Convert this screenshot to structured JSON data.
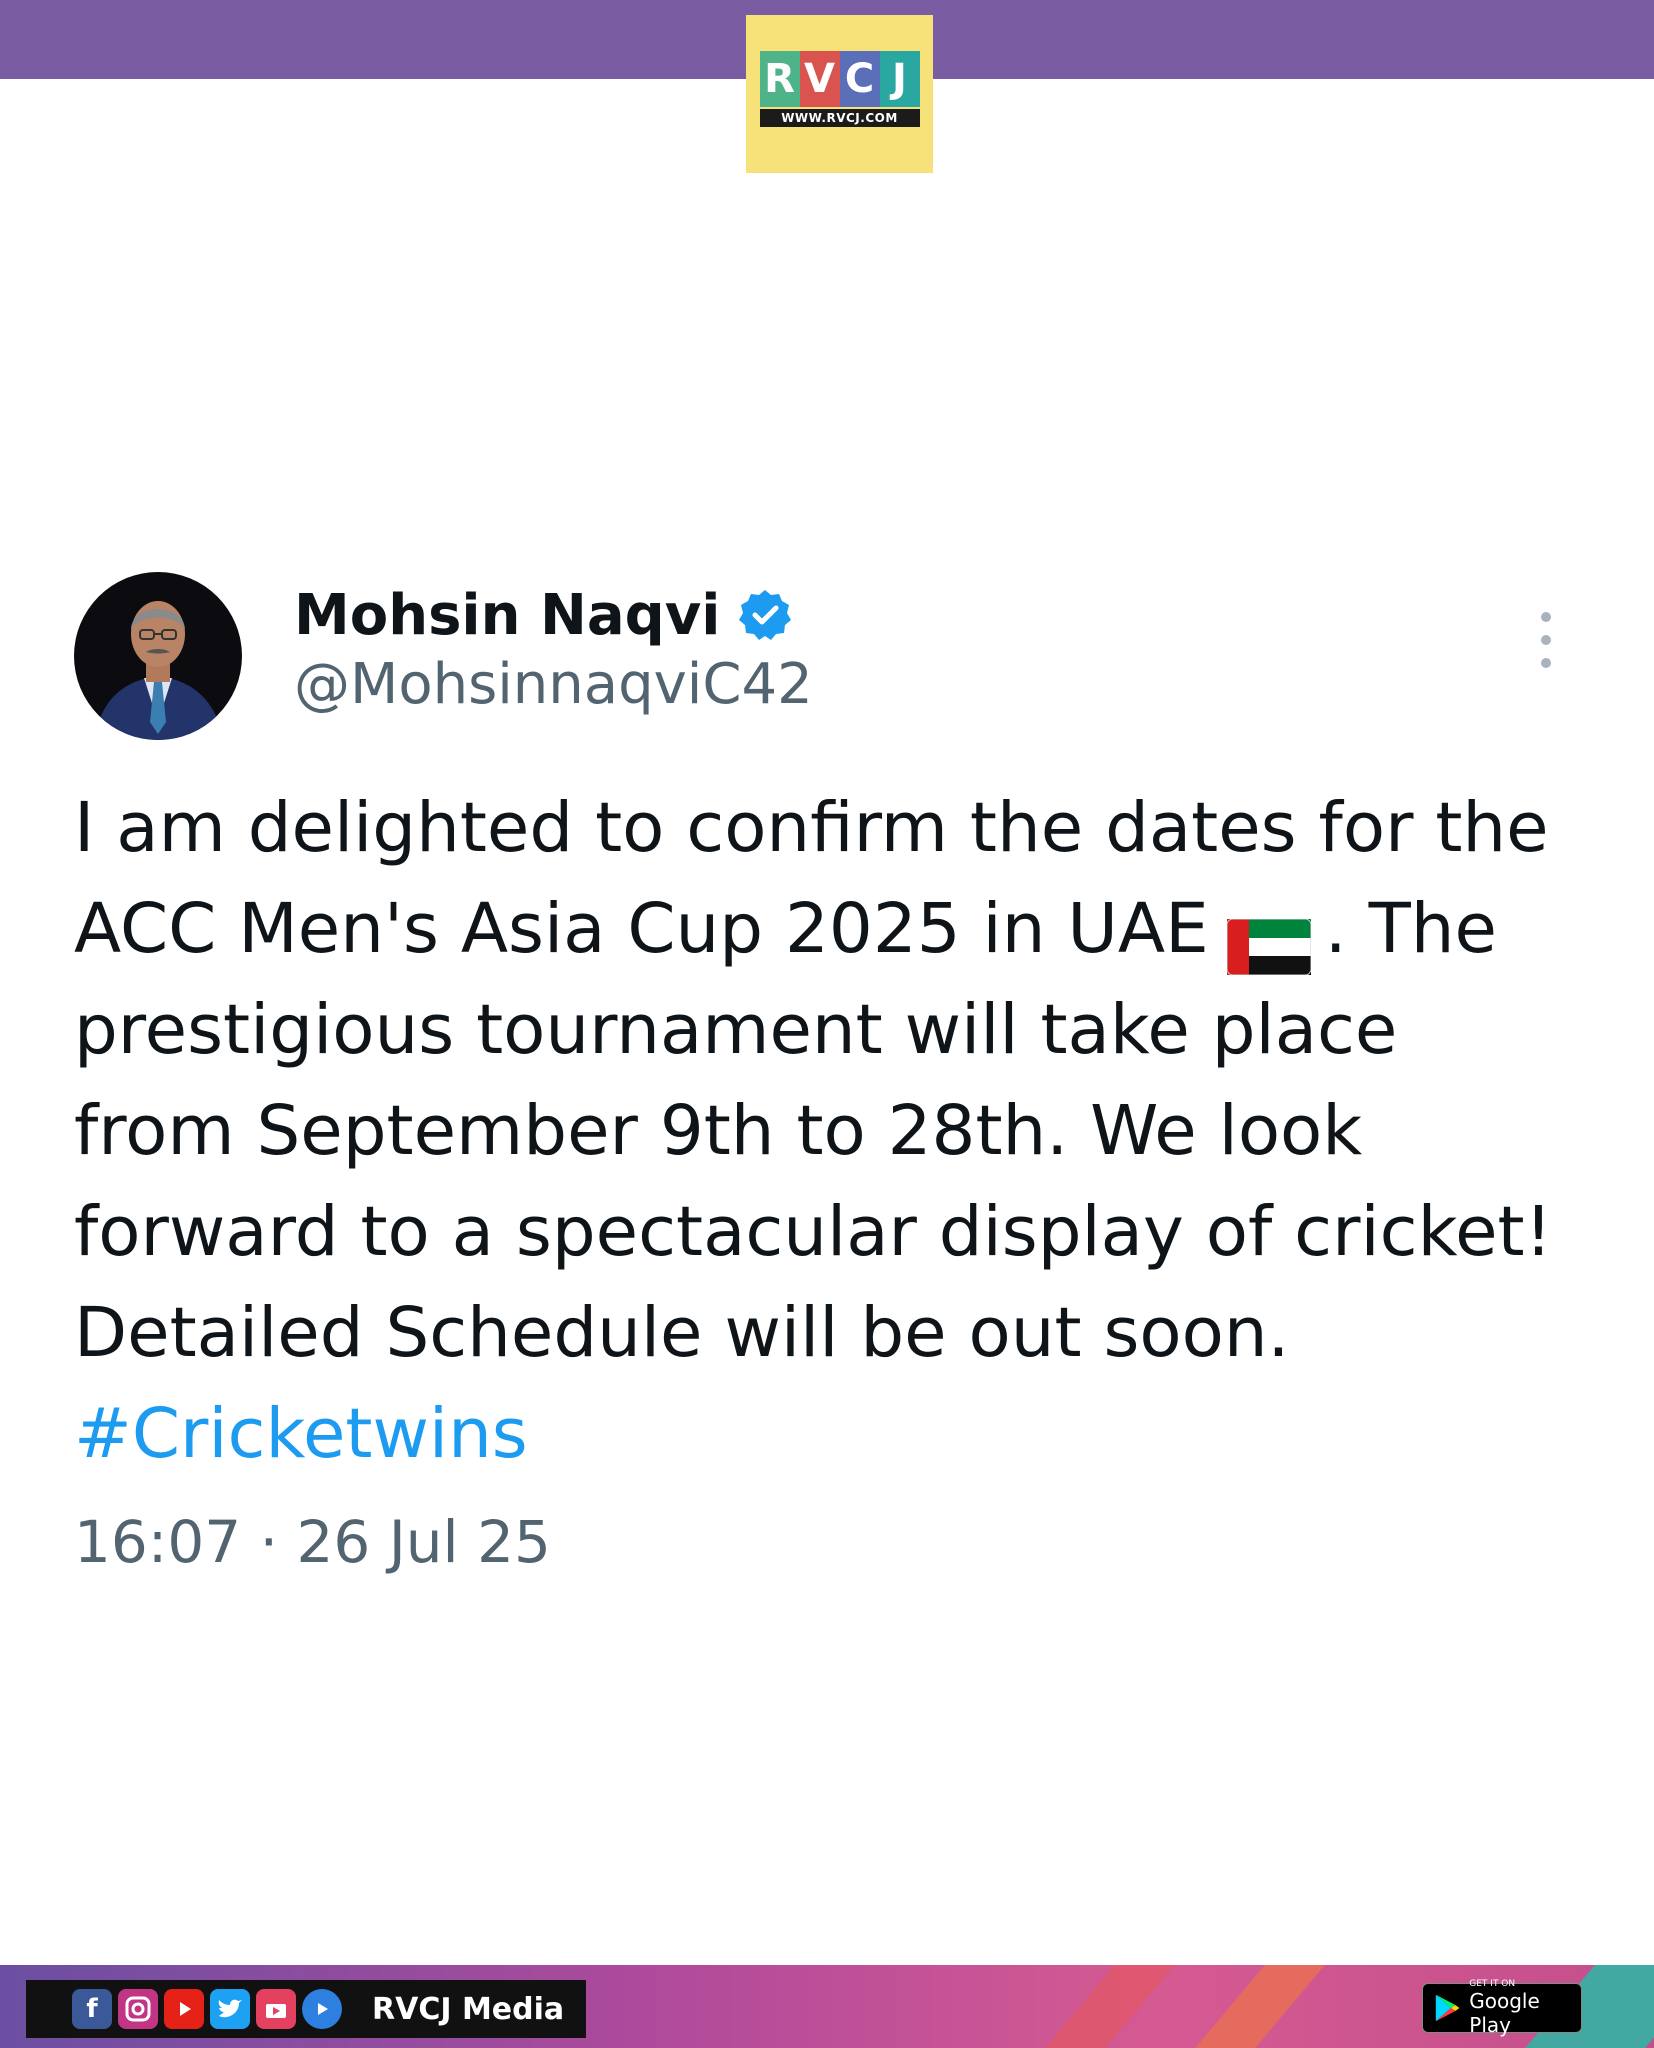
{
  "logo": {
    "letters": [
      "R",
      "V",
      "C",
      "J"
    ],
    "letter_colors": [
      "#4fb38a",
      "#d9534f",
      "#5a6fb8",
      "#2aa7a0"
    ],
    "url": "WWW.RVCJ.COM"
  },
  "tweet": {
    "author_name": "Mohsin Naqvi",
    "handle": "@MohsinnaqviC42",
    "verified_icon": "verified-badge-icon",
    "body_lines": [
      "I am delighted to confirm the dates for the",
      "ACC Men's Asia Cup 2025 in UAE",
      ". The",
      "prestigious tournament will take place",
      "from September 9th to 28th. We look",
      "forward to a spectacular display of cricket!",
      "Detailed Schedule will be out soon."
    ],
    "flag_icon": "uae-flag-icon",
    "hashtag": "#Cricketwins",
    "timestamp": "16:07 · 26 Jul 25"
  },
  "footer": {
    "social_icons": [
      "facebook-icon",
      "instagram-icon",
      "youtube-icon",
      "twitter-icon",
      "video-icon",
      "play-icon"
    ],
    "brand_label": "RVCJ Media",
    "play_badge_small": "GET IT ON",
    "play_badge_big": "Google Play"
  },
  "colors": {
    "top_bar": "#7a5ca3",
    "logo_bg": "#f7e27a",
    "hashtag": "#1d9bf0",
    "verified": "#1d9bf0",
    "muted_text": "#536471"
  }
}
